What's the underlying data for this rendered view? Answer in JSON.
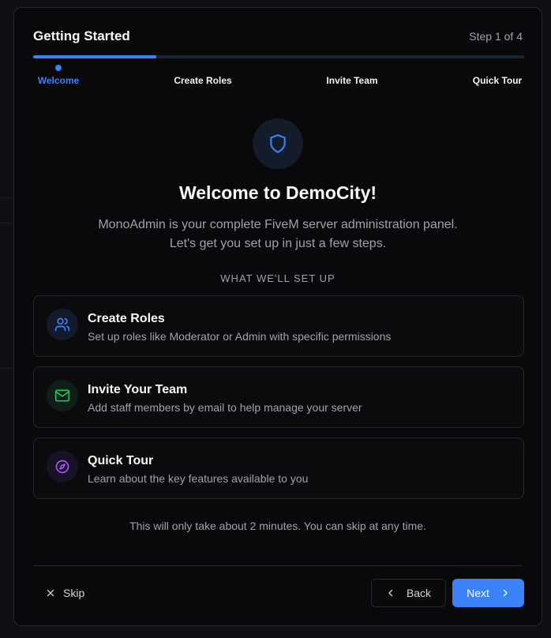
{
  "header": {
    "title": "Getting Started",
    "step_count": "Step 1 of 4"
  },
  "progress": {
    "current_step": 1,
    "total_steps": 4
  },
  "steps": [
    {
      "label": "Welcome",
      "active": true
    },
    {
      "label": "Create Roles",
      "active": false
    },
    {
      "label": "Invite Team",
      "active": false
    },
    {
      "label": "Quick Tour",
      "active": false
    }
  ],
  "hero": {
    "icon": "shield-icon",
    "heading": "Welcome to DemoCity!",
    "subtitle": "MonoAdmin is your complete FiveM server administration panel. Let's get you set up in just a few steps."
  },
  "section_label": "WHAT WE'LL SET UP",
  "cards": [
    {
      "icon": "users-icon",
      "title": "Create Roles",
      "description": "Set up roles like Moderator or Admin with specific permissions",
      "color": "#3b82f6"
    },
    {
      "icon": "mail-icon",
      "title": "Invite Your Team",
      "description": "Add staff members by email to help manage your server",
      "color": "#22c55e"
    },
    {
      "icon": "compass-icon",
      "title": "Quick Tour",
      "description": "Learn about the key features available to you",
      "color": "#a855f7"
    }
  ],
  "note": "This will only take about 2 minutes. You can skip at any time.",
  "footer": {
    "skip_label": "Skip",
    "back_label": "Back",
    "next_label": "Next"
  },
  "colors": {
    "accent": "#3b82f6",
    "background": "#09090b",
    "border": "#26262c"
  }
}
